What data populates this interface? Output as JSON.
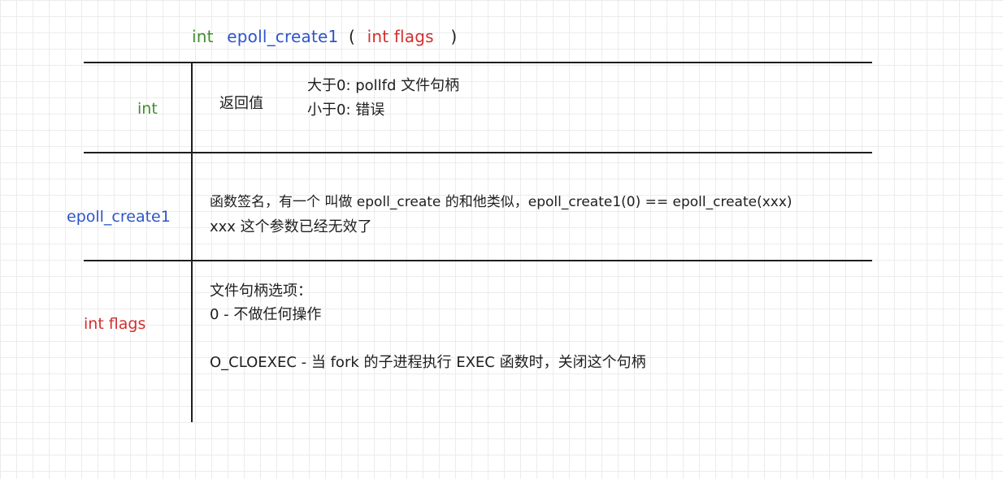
{
  "signature": {
    "return_type": "int",
    "function_name": "epoll_create1",
    "open_paren": "(",
    "param": "int flags",
    "close_paren": ")"
  },
  "rows": [
    {
      "label": "int",
      "heading": "返回值",
      "lines": [
        "大于0: pollfd 文件句柄",
        "小于0: 错误"
      ]
    },
    {
      "label": "epoll_create1",
      "lines": [
        "函数签名，有一个 叫做 epoll_create 的和他类似，epoll_create1(0) == epoll_create(xxx)",
        "xxx 这个参数已经无效了"
      ]
    },
    {
      "label": "int flags",
      "lines": [
        "文件句柄选项：",
        "0  -  不做任何操作",
        "O_CLOEXEC  -  当 fork 的子进程执行 EXEC 函数时，关闭这个句柄"
      ]
    }
  ],
  "colors": {
    "type": "#3f8f2c",
    "function": "#2e55c8",
    "param": "#d22f2f",
    "ink": "#1e1e1e"
  }
}
